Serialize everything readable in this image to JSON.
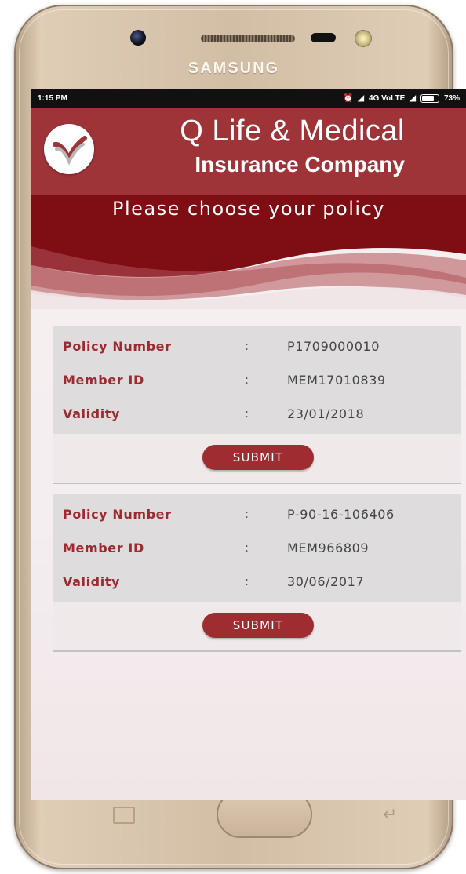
{
  "device": {
    "brand": "SAMSUNG"
  },
  "status_bar": {
    "time": "1:15 PM",
    "network": "4G VoLTE",
    "battery": "73%"
  },
  "header": {
    "company_line1": "Q Life & Medical",
    "company_line2": "Insurance Company",
    "logo_icon": "checkmark-logo-icon"
  },
  "page_title": "Please choose your policy",
  "policies": [
    {
      "policy_number_label": "Policy Number",
      "policy_number": "P1709000010",
      "member_id_label": "Member ID",
      "member_id": "MEM17010839",
      "validity_label": "Validity",
      "validity": "23/01/2018",
      "separator": ":",
      "submit_label": "SUBMIT"
    },
    {
      "policy_number_label": "Policy Number",
      "policy_number": "P-90-16-106406",
      "member_id_label": "Member ID",
      "member_id": "MEM966809",
      "validity_label": "Validity",
      "validity": "30/06/2017",
      "separator": ":",
      "submit_label": "SUBMIT"
    }
  ],
  "colors": {
    "brand": "#9e3438",
    "title_band": "#7f0d14",
    "label": "#9b2b31",
    "button": "#9e2c31"
  }
}
